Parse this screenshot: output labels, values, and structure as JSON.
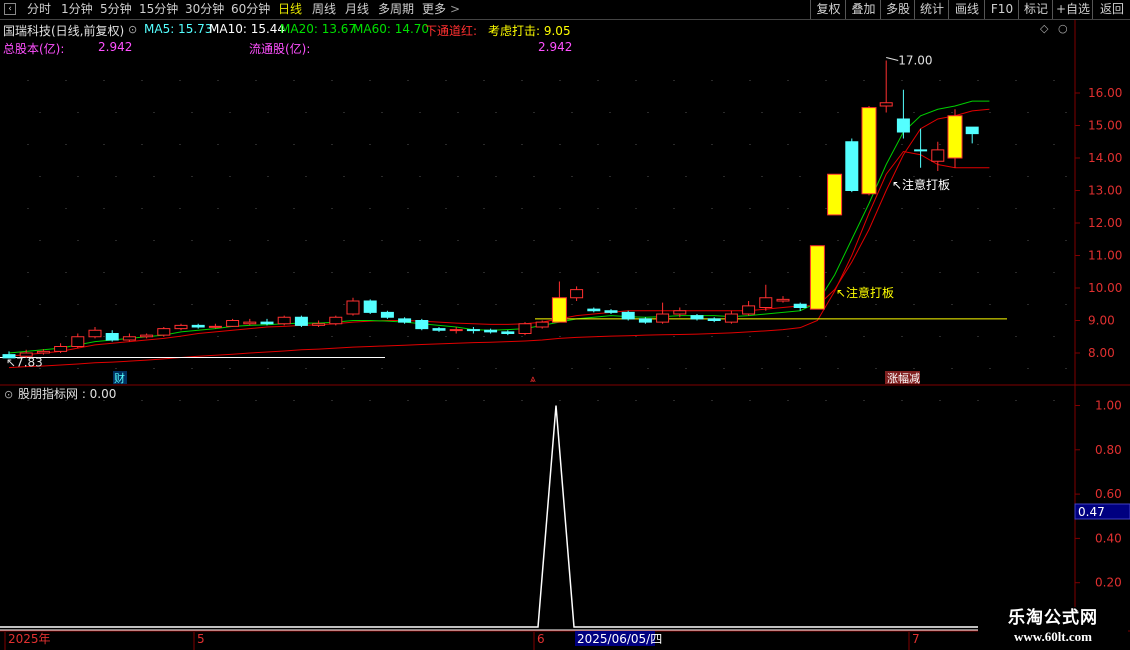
{
  "toolbar": {
    "periods": [
      "分时",
      "1分钟",
      "5分钟",
      "15分钟",
      "30分钟",
      "60分钟",
      "日线",
      "周线",
      "月线",
      "多周期",
      "更多"
    ],
    "active_period": "日线",
    "more_arrow": ">",
    "right_buttons": [
      "复权",
      "叠加",
      "多股",
      "统计",
      "画线",
      "F10",
      "标记",
      "+自选",
      "返回"
    ]
  },
  "header": {
    "stock_title": "国瑞科技(日线,前复权)",
    "ma5": "MA5: 15.73",
    "ma10": "MA10: 15.44",
    "ma20": "MA20: 13.67",
    "ma60": "MA60: 14.70",
    "xiatong": "下通道红:",
    "kaohu": "考虑打击: 9.05",
    "total_share_label": "总股本(亿):",
    "total_share_value": "2.942",
    "float_share_label": "流通股(亿):",
    "float_share_value": "2.942"
  },
  "annotations": {
    "high": "17.00",
    "low": "7.83",
    "note1": "注意打板",
    "note2": "注意打板",
    "cai": "财",
    "zhangfu": "涨幅减"
  },
  "indicator": {
    "name": "股朋指标网 : 0.00",
    "cursor_value": "0.47",
    "axis_ticks": [
      "1.00",
      "0.80",
      "0.60",
      "0.40",
      "0.20"
    ],
    "peak_value": 1.0
  },
  "price_axis": {
    "ticks": [
      "16.00",
      "15.00",
      "14.00",
      "13.00",
      "12.00",
      "11.00",
      "10.00",
      "9.00",
      "8.00"
    ]
  },
  "date_axis": {
    "labels": [
      "2025年",
      "5",
      "6",
      "7"
    ],
    "cursor_date": "2025/06/05/四"
  },
  "colors": {
    "up": "#ff3030",
    "down": "#54ffff",
    "signal": "#ffff00",
    "ma_green": "#00d000",
    "ma_red": "#e00000",
    "grid": "#800000"
  },
  "chart_data": {
    "type": "candlestick",
    "levels": {
      "high_mark": 17.0,
      "low_mark": 7.83,
      "yellow_line": 9.05
    },
    "candles": [
      {
        "o": 7.95,
        "c": 7.85,
        "h": 8.05,
        "l": 7.83,
        "t": "d"
      },
      {
        "o": 7.9,
        "c": 8.0,
        "h": 8.1,
        "l": 7.85,
        "t": "u"
      },
      {
        "o": 8.0,
        "c": 8.05,
        "h": 8.12,
        "l": 7.95,
        "t": "u"
      },
      {
        "o": 8.05,
        "c": 8.2,
        "h": 8.3,
        "l": 8.0,
        "t": "u"
      },
      {
        "o": 8.2,
        "c": 8.5,
        "h": 8.6,
        "l": 8.15,
        "t": "u"
      },
      {
        "o": 8.5,
        "c": 8.7,
        "h": 8.8,
        "l": 8.45,
        "t": "u"
      },
      {
        "o": 8.6,
        "c": 8.4,
        "h": 8.7,
        "l": 8.35,
        "t": "d"
      },
      {
        "o": 8.4,
        "c": 8.5,
        "h": 8.6,
        "l": 8.35,
        "t": "u"
      },
      {
        "o": 8.5,
        "c": 8.55,
        "h": 8.6,
        "l": 8.45,
        "t": "u"
      },
      {
        "o": 8.55,
        "c": 8.75,
        "h": 8.8,
        "l": 8.5,
        "t": "u"
      },
      {
        "o": 8.75,
        "c": 8.85,
        "h": 8.9,
        "l": 8.7,
        "t": "u"
      },
      {
        "o": 8.85,
        "c": 8.8,
        "h": 8.9,
        "l": 8.75,
        "t": "d"
      },
      {
        "o": 8.8,
        "c": 8.82,
        "h": 8.9,
        "l": 8.75,
        "t": "u"
      },
      {
        "o": 8.82,
        "c": 9.0,
        "h": 9.05,
        "l": 8.8,
        "t": "u"
      },
      {
        "o": 8.9,
        "c": 8.95,
        "h": 9.05,
        "l": 8.85,
        "t": "u"
      },
      {
        "o": 8.95,
        "c": 8.9,
        "h": 9.05,
        "l": 8.85,
        "t": "d"
      },
      {
        "o": 8.9,
        "c": 9.1,
        "h": 9.15,
        "l": 8.85,
        "t": "u"
      },
      {
        "o": 9.1,
        "c": 8.85,
        "h": 9.15,
        "l": 8.8,
        "t": "d"
      },
      {
        "o": 8.85,
        "c": 8.9,
        "h": 9.0,
        "l": 8.8,
        "t": "u"
      },
      {
        "o": 8.9,
        "c": 9.1,
        "h": 9.15,
        "l": 8.85,
        "t": "u"
      },
      {
        "o": 9.2,
        "c": 9.6,
        "h": 9.7,
        "l": 9.15,
        "t": "u"
      },
      {
        "o": 9.6,
        "c": 9.25,
        "h": 9.65,
        "l": 9.2,
        "t": "d"
      },
      {
        "o": 9.25,
        "c": 9.1,
        "h": 9.3,
        "l": 9.05,
        "t": "d"
      },
      {
        "o": 9.05,
        "c": 8.95,
        "h": 9.1,
        "l": 8.9,
        "t": "d"
      },
      {
        "o": 9.0,
        "c": 8.75,
        "h": 9.05,
        "l": 8.7,
        "t": "d"
      },
      {
        "o": 8.75,
        "c": 8.7,
        "h": 8.8,
        "l": 8.65,
        "t": "d"
      },
      {
        "o": 8.7,
        "c": 8.72,
        "h": 8.8,
        "l": 8.6,
        "t": "u"
      },
      {
        "o": 8.72,
        "c": 8.7,
        "h": 8.8,
        "l": 8.6,
        "t": "d"
      },
      {
        "o": 8.7,
        "c": 8.65,
        "h": 8.75,
        "l": 8.6,
        "t": "d"
      },
      {
        "o": 8.65,
        "c": 8.6,
        "h": 8.7,
        "l": 8.55,
        "t": "d"
      },
      {
        "o": 8.6,
        "c": 8.9,
        "h": 8.95,
        "l": 8.55,
        "t": "u"
      },
      {
        "o": 8.8,
        "c": 8.95,
        "h": 9.0,
        "l": 8.75,
        "t": "u"
      },
      {
        "o": 8.95,
        "c": 9.7,
        "h": 10.2,
        "l": 8.95,
        "t": "s"
      },
      {
        "o": 9.7,
        "c": 9.95,
        "h": 10.05,
        "l": 9.6,
        "t": "u"
      },
      {
        "o": 9.35,
        "c": 9.3,
        "h": 9.4,
        "l": 9.25,
        "t": "d"
      },
      {
        "o": 9.3,
        "c": 9.25,
        "h": 9.35,
        "l": 9.2,
        "t": "d"
      },
      {
        "o": 9.25,
        "c": 9.05,
        "h": 9.3,
        "l": 9.0,
        "t": "d"
      },
      {
        "o": 9.05,
        "c": 8.95,
        "h": 9.1,
        "l": 8.9,
        "t": "d"
      },
      {
        "o": 8.95,
        "c": 9.2,
        "h": 9.55,
        "l": 8.9,
        "t": "u"
      },
      {
        "o": 9.2,
        "c": 9.3,
        "h": 9.4,
        "l": 9.1,
        "t": "u"
      },
      {
        "o": 9.15,
        "c": 9.05,
        "h": 9.2,
        "l": 9.0,
        "t": "d"
      },
      {
        "o": 9.05,
        "c": 9.0,
        "h": 9.1,
        "l": 8.95,
        "t": "d"
      },
      {
        "o": 8.95,
        "c": 9.2,
        "h": 9.3,
        "l": 8.9,
        "t": "u"
      },
      {
        "o": 9.2,
        "c": 9.45,
        "h": 9.6,
        "l": 9.15,
        "t": "u"
      },
      {
        "o": 9.4,
        "c": 9.7,
        "h": 10.1,
        "l": 9.3,
        "t": "u"
      },
      {
        "o": 9.65,
        "c": 9.6,
        "h": 9.75,
        "l": 9.55,
        "t": "u"
      },
      {
        "o": 9.5,
        "c": 9.4,
        "h": 9.55,
        "l": 9.3,
        "t": "d"
      },
      {
        "o": 9.35,
        "c": 11.3,
        "h": 11.3,
        "l": 9.35,
        "t": "s"
      },
      {
        "o": 12.25,
        "c": 13.5,
        "h": 13.5,
        "l": 12.25,
        "t": "s"
      },
      {
        "o": 13.0,
        "c": 14.5,
        "h": 14.6,
        "l": 12.95,
        "t": "d"
      },
      {
        "o": 12.9,
        "c": 15.55,
        "h": 15.6,
        "l": 12.85,
        "t": "s"
      },
      {
        "o": 15.6,
        "c": 15.7,
        "h": 17.0,
        "l": 15.4,
        "t": "u"
      },
      {
        "o": 15.2,
        "c": 14.8,
        "h": 16.1,
        "l": 14.6,
        "t": "d"
      },
      {
        "o": 14.25,
        "c": 14.25,
        "h": 14.9,
        "l": 13.7,
        "t": "d"
      },
      {
        "o": 13.9,
        "c": 14.25,
        "h": 14.5,
        "l": 13.6,
        "t": "u"
      },
      {
        "o": 14.0,
        "c": 15.3,
        "h": 15.5,
        "l": 13.7,
        "t": "s"
      },
      {
        "o": 14.95,
        "c": 14.75,
        "h": 14.95,
        "l": 14.45,
        "t": "d"
      }
    ],
    "ma_green": [
      8.0,
      8.05,
      8.1,
      8.15,
      8.25,
      8.35,
      8.4,
      8.45,
      8.5,
      8.55,
      8.65,
      8.7,
      8.75,
      8.82,
      8.85,
      8.87,
      8.9,
      8.92,
      8.92,
      8.95,
      9.0,
      9.0,
      8.98,
      8.95,
      8.9,
      8.85,
      8.8,
      8.72,
      8.7,
      8.72,
      8.75,
      8.85,
      8.95,
      9.05,
      9.1,
      9.15,
      9.12,
      9.1,
      9.12,
      9.15,
      9.15,
      9.15,
      9.12,
      9.15,
      9.2,
      9.25,
      9.3,
      9.55,
      10.4,
      11.5,
      12.6,
      13.8,
      14.8,
      15.3,
      15.5,
      15.6,
      15.75,
      15.75
    ],
    "ma_red1": [
      7.9,
      7.95,
      8.0,
      8.05,
      8.15,
      8.25,
      8.3,
      8.35,
      8.4,
      8.45,
      8.52,
      8.6,
      8.65,
      8.7,
      8.75,
      8.8,
      8.82,
      8.85,
      8.87,
      8.9,
      8.95,
      8.98,
      9.0,
      9.0,
      8.98,
      8.95,
      8.92,
      8.9,
      8.88,
      8.88,
      8.9,
      8.95,
      9.05,
      9.15,
      9.2,
      9.25,
      9.3,
      9.3,
      9.3,
      9.3,
      9.3,
      9.3,
      9.3,
      9.3,
      9.35,
      9.4,
      9.45,
      9.45,
      9.95,
      10.8,
      11.8,
      13.0,
      14.1,
      14.9,
      15.2,
      15.3,
      15.45,
      15.5
    ],
    "ma_red2": [
      7.55,
      7.58,
      7.6,
      7.63,
      7.66,
      7.7,
      7.72,
      7.75,
      7.78,
      7.82,
      7.86,
      7.9,
      7.93,
      7.96,
      8.0,
      8.03,
      8.06,
      8.1,
      8.12,
      8.15,
      8.18,
      8.2,
      8.22,
      8.24,
      8.26,
      8.28,
      8.3,
      8.32,
      8.33,
      8.35,
      8.37,
      8.4,
      8.45,
      8.48,
      8.5,
      8.52,
      8.53,
      8.55,
      8.56,
      8.57,
      8.58,
      8.6,
      8.62,
      8.65,
      8.68,
      8.72,
      8.78,
      9.0,
      9.9,
      11.0,
      12.3,
      13.5,
      14.2,
      14.1,
      13.8,
      13.7,
      13.7,
      13.7
    ],
    "indicator_series": {
      "peak_index": 32,
      "baseline": 0.0,
      "peak": 1.0
    }
  }
}
